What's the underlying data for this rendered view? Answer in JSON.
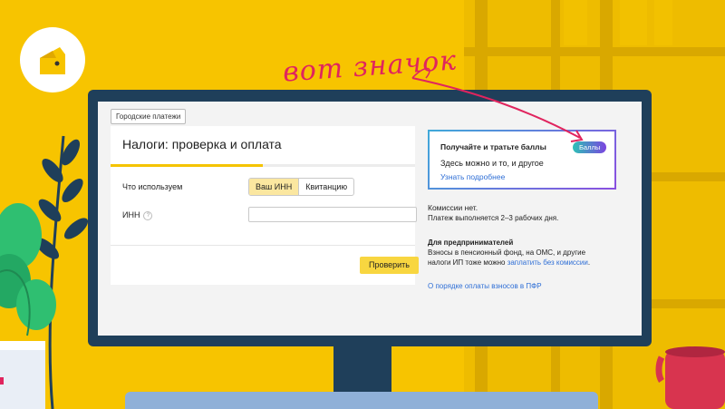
{
  "overlay": {
    "handwritten_text": "вот значок"
  },
  "page": {
    "city_button": "Городские платежи",
    "card": {
      "title": "Налоги: проверка и оплата",
      "progress": 0.5,
      "use_label": "Что используем",
      "segments": [
        "Ваш ИНН",
        "Квитанцию"
      ],
      "selected_segment": "Ваш ИНН",
      "inn_label": "ИНН",
      "hint_icon": "?",
      "inn_value": "",
      "check_button": "Проверить"
    },
    "promo": {
      "title": "Получайте и тратьте баллы",
      "badge": "Баллы",
      "text": "Здесь можно и то, и другое",
      "link": "Узнать подробнее"
    },
    "commission": {
      "line1": "Комиссии нет.",
      "line2": "Платеж выполняется 2–3 рабочих дня."
    },
    "entrepreneurs": {
      "title": "Для предпринимателей",
      "line1": "Взносы в пенсионный фонд, на ОМС, и другие",
      "line2_prefix": "налоги ИП тоже можно",
      "line2_link": "заплатить без комиссии",
      "line2_suffix": "."
    },
    "pfr_link": "О порядке оплаты взносов в ПФР"
  },
  "colors": {
    "background": "#f7c400",
    "monitor": "#1f3f5a",
    "accent": "#f8d640",
    "link": "#2f6fd6",
    "handwriting": "#e0245e"
  }
}
